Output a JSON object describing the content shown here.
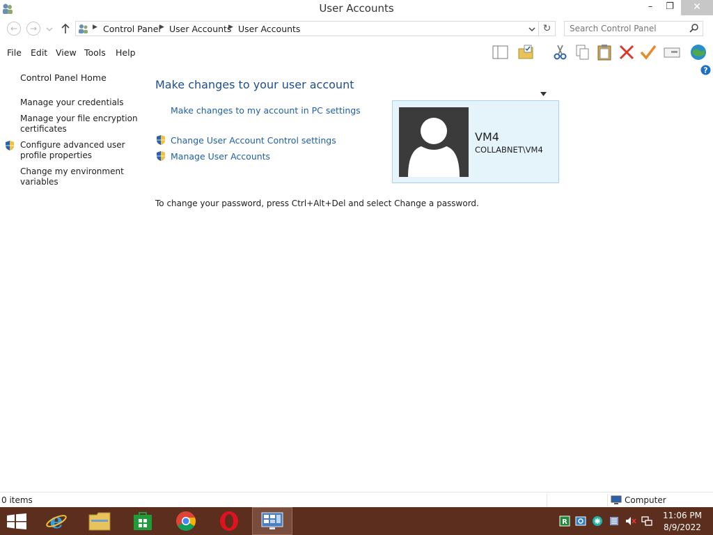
{
  "window": {
    "title": "User Accounts",
    "minimize": "–",
    "restore": "❐",
    "close": "✕"
  },
  "address": {
    "crumbs": [
      "Control Panel",
      "User Accounts",
      "User Accounts"
    ],
    "search_placeholder": "Search Control Panel"
  },
  "menu": {
    "file": "File",
    "edit": "Edit",
    "view": "View",
    "tools": "Tools",
    "help": "Help"
  },
  "left_pane": {
    "home": "Control Panel Home",
    "credentials": "Manage your credentials",
    "encryption": "Manage your file encryption certificates",
    "profile": "Configure advanced user profile properties",
    "environment": "Change my environment variables"
  },
  "content": {
    "heading": "Make changes to your user account",
    "pc_settings_link": "Make changes to my account in PC settings",
    "uac_link": "Change User Account Control settings",
    "manage_link": "Manage User Accounts",
    "password_note": "To change your password, press Ctrl+Alt+Del and select Change a password."
  },
  "user": {
    "name": "VM4",
    "domain": "COLLABNET\\VM4"
  },
  "status": {
    "count": "0 items",
    "location": "Computer"
  },
  "taskbar": {
    "time": "11:06 PM",
    "date": "8/9/2022"
  },
  "colors": {
    "link": "#1e5fa8",
    "heading": "#1e4e8c",
    "taskbar": "#5b2e1e",
    "card_bg": "#e5f3fb"
  }
}
